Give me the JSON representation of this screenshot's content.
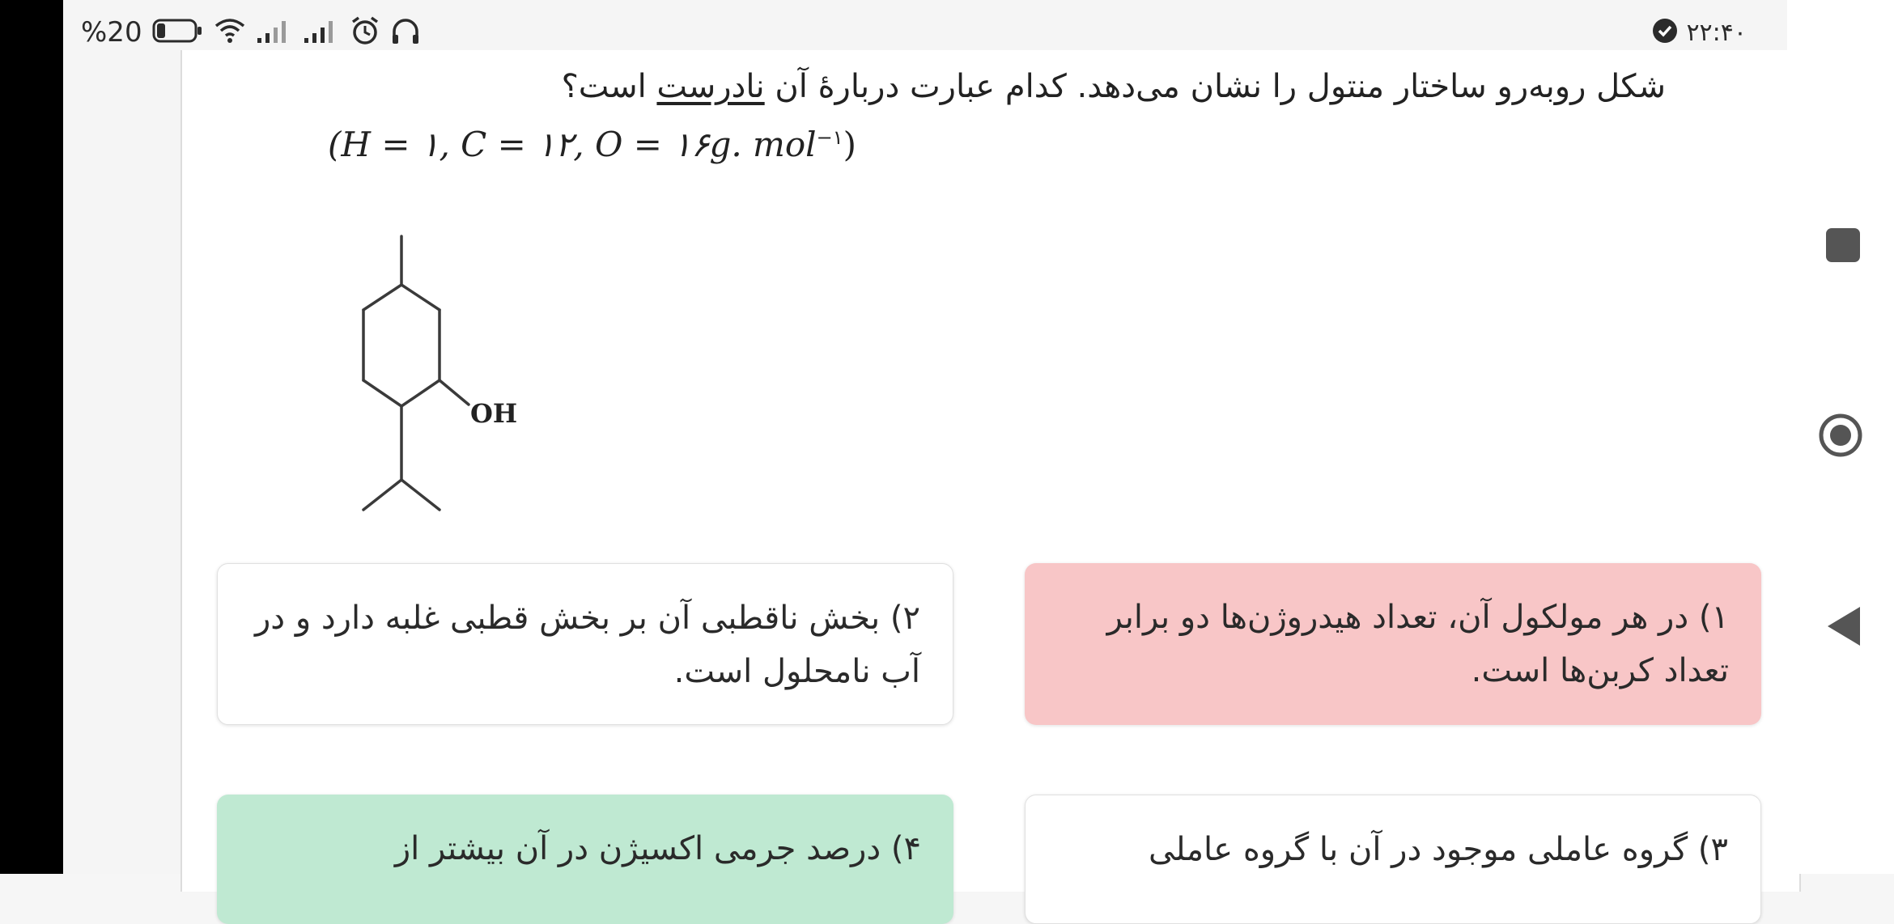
{
  "status_bar": {
    "battery_percent": "%20",
    "time": "۲۲:۴۰",
    "icons": [
      "battery-icon",
      "wifi-icon",
      "signal-icon",
      "signal-icon",
      "alarm-icon",
      "headphones-icon",
      "check-circle-icon"
    ]
  },
  "question": {
    "text_before": "شکل روبه‌رو ساختار منتول را نشان می‌دهد. کدام عبارت دربارهٔ آن ",
    "underlined": "نادرست",
    "text_after": " است؟",
    "formula": {
      "main": "(H = ۱, C = ۱۲, O = ۱۶g. mol",
      "superscript": "−۱",
      "close": ")"
    },
    "structure_label": "OH"
  },
  "options": [
    {
      "number": "۱)",
      "text": "در هر مولکول آن، تعداد هیدروژن‌ها دو برابر تعداد کربن‌ها است.",
      "state": "incorrect",
      "color": "#f8c6c7"
    },
    {
      "number": "۲)",
      "text": "بخش ناقطبی آن بر بخش قطبی غلبه دارد و در آب نامحلول است.",
      "state": "neutral",
      "color": "#ffffff"
    },
    {
      "number": "۳)",
      "text": "گروه عاملی موجود در آن با گروه عاملی",
      "state": "neutral",
      "color": "#ffffff"
    },
    {
      "number": "۴)",
      "text": "درصد جرمی اکسیژن در آن بیشتر از",
      "state": "correct",
      "color": "#bfe9d2"
    }
  ],
  "nav_bar": {
    "icons": [
      "recent-apps-icon",
      "home-icon",
      "back-icon"
    ]
  }
}
